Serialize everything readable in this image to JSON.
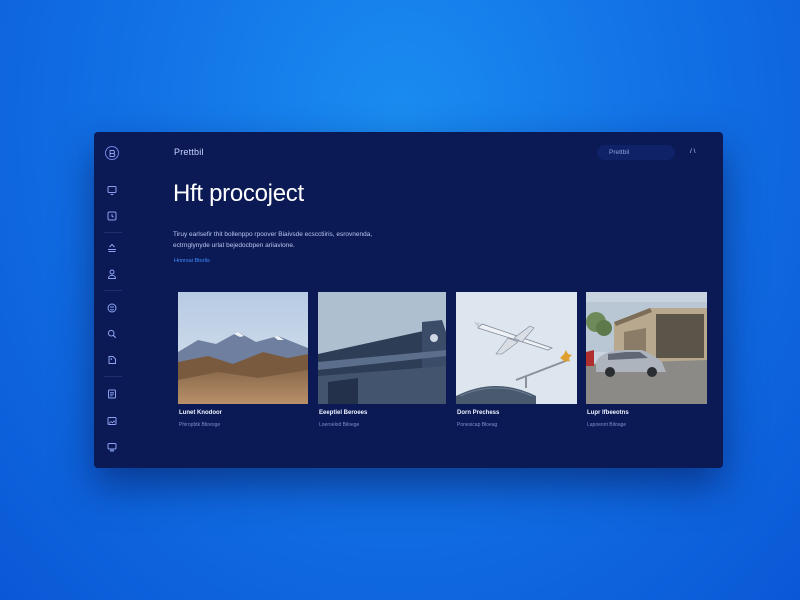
{
  "header": {
    "breadcrumb": "Prettbil",
    "search_placeholder": "Prettbil",
    "top_right": "/ \\"
  },
  "main": {
    "title": "Hft procoject",
    "description": "Tiruy earlsefir thit bollenppo rpoover Biaivsde ecscctiiris, esrovnenda, ectrnglynyde urlat bejedocbpen ariiavione.",
    "link_label": "Hnnrsai Btorlis"
  },
  "sidebar": {
    "items": [
      {
        "icon": "monitor-icon"
      },
      {
        "icon": "clock-icon"
      },
      {
        "icon": "upload-icon"
      },
      {
        "icon": "user-icon"
      },
      {
        "icon": "smiley-icon"
      },
      {
        "icon": "search-icon"
      },
      {
        "icon": "tag-icon"
      },
      {
        "icon": "document-icon"
      },
      {
        "icon": "image-icon"
      },
      {
        "icon": "display-icon"
      }
    ]
  },
  "cards": [
    {
      "name": "Lunet Knodoor",
      "meta": "Phiropbtk Btireoge",
      "image": "mountain-landscape"
    },
    {
      "name": "Eeeptiel Beroees",
      "meta": "Loeroelod Biloege",
      "image": "modern-building"
    },
    {
      "name": "Dorn Prechess",
      "meta": "Ponesicap Bloeag",
      "image": "airplane-crane"
    },
    {
      "name": "Lupr lfbeeotns",
      "meta": "Lapoeont Bitoage",
      "image": "car-garage"
    }
  ],
  "colors": {
    "background": "#1272e6",
    "panel": "#0b1a55",
    "accent": "#3f8cff",
    "text": "#ffffff"
  }
}
